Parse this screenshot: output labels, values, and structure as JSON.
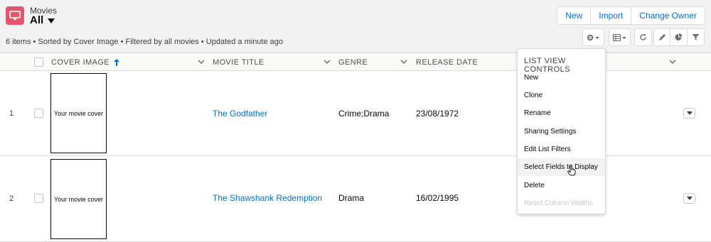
{
  "header": {
    "object_label": "Movies",
    "view_name": "All",
    "status": "6 items • Sorted by Cover Image • Filtered by all movies • Updated a minute ago",
    "buttons": [
      "New",
      "Import",
      "Change Owner"
    ]
  },
  "table": {
    "columns": [
      "COVER IMAGE",
      "MOVIE TITLE",
      "GENRE",
      "RELEASE DATE"
    ],
    "rows": [
      {
        "num": "1",
        "cover": "Your movie cover",
        "title": "The Godfather",
        "genre": "Crime;Drama",
        "release": "23/08/1972"
      },
      {
        "num": "2",
        "cover": "Your movie cover",
        "title": "The Shawshank Redemption",
        "genre": "Drama",
        "release": "16/02/1995"
      }
    ]
  },
  "menu": {
    "heading": "LIST VIEW CONTROLS",
    "items": [
      "New",
      "Clone",
      "Rename",
      "Sharing Settings",
      "Edit List Filters",
      "Select Fields to Display",
      "Delete",
      "Reset Column Widths"
    ]
  },
  "colors": {
    "accent": "#0070d2",
    "object_icon": "#e3566e"
  }
}
